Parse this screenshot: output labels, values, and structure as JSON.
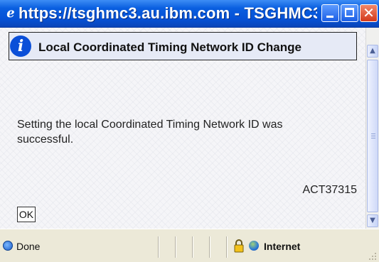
{
  "window": {
    "title": "https://tsghmc3.au.ibm.com - TSGHMC3: ...",
    "title_icon": "ie-page-icon",
    "accent": "#0551d6"
  },
  "dialog": {
    "heading": "Local Coordinated Timing Network ID Change",
    "heading_icon": "info-icon",
    "heading_icon_glyph": "i",
    "message": "Setting the local Coordinated Timing Network ID was successful.",
    "message_code": "ACT37315",
    "ok_label": "OK"
  },
  "status_bar": {
    "status_text": "Done",
    "zone_text": "Internet"
  }
}
